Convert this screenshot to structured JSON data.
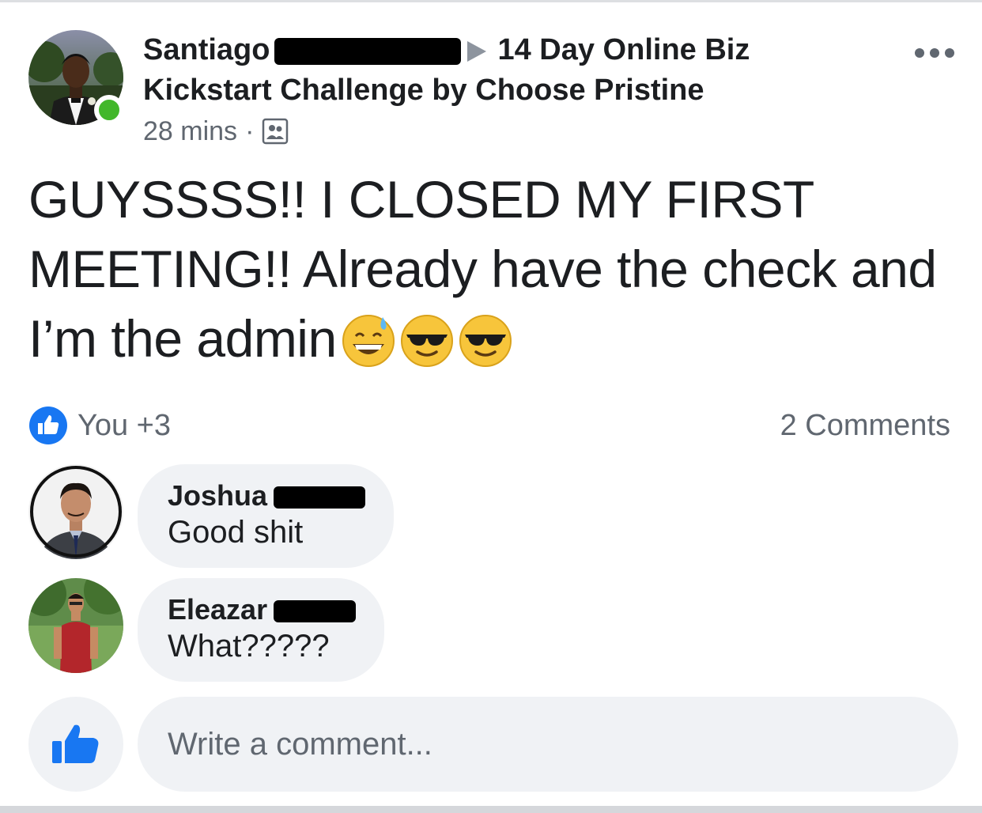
{
  "post": {
    "author": "Santiago",
    "group": "14 Day Online Biz Kickstart Challenge by Choose Pristine",
    "time": "28 mins",
    "separator": "·",
    "audience_icon": "group-audience-icon",
    "text": "GUYSSSS!! I CLOSED MY FIRST MEETING!! Already have the check and I’m the admin",
    "emojis": [
      "grinning-sweat-emoji",
      "sunglasses-emoji",
      "sunglasses-emoji"
    ]
  },
  "reactions": {
    "summary": "You +3",
    "comments_count": "2 Comments"
  },
  "comments": [
    {
      "name": "Joshua",
      "text": "Good shit"
    },
    {
      "name": "Eleazar",
      "text": "What?????"
    }
  ],
  "composer": {
    "placeholder": "Write a comment..."
  },
  "colors": {
    "accent": "#1877f2",
    "online": "#42b72a",
    "bubble": "#f0f2f5",
    "secondary_text": "#606770"
  }
}
